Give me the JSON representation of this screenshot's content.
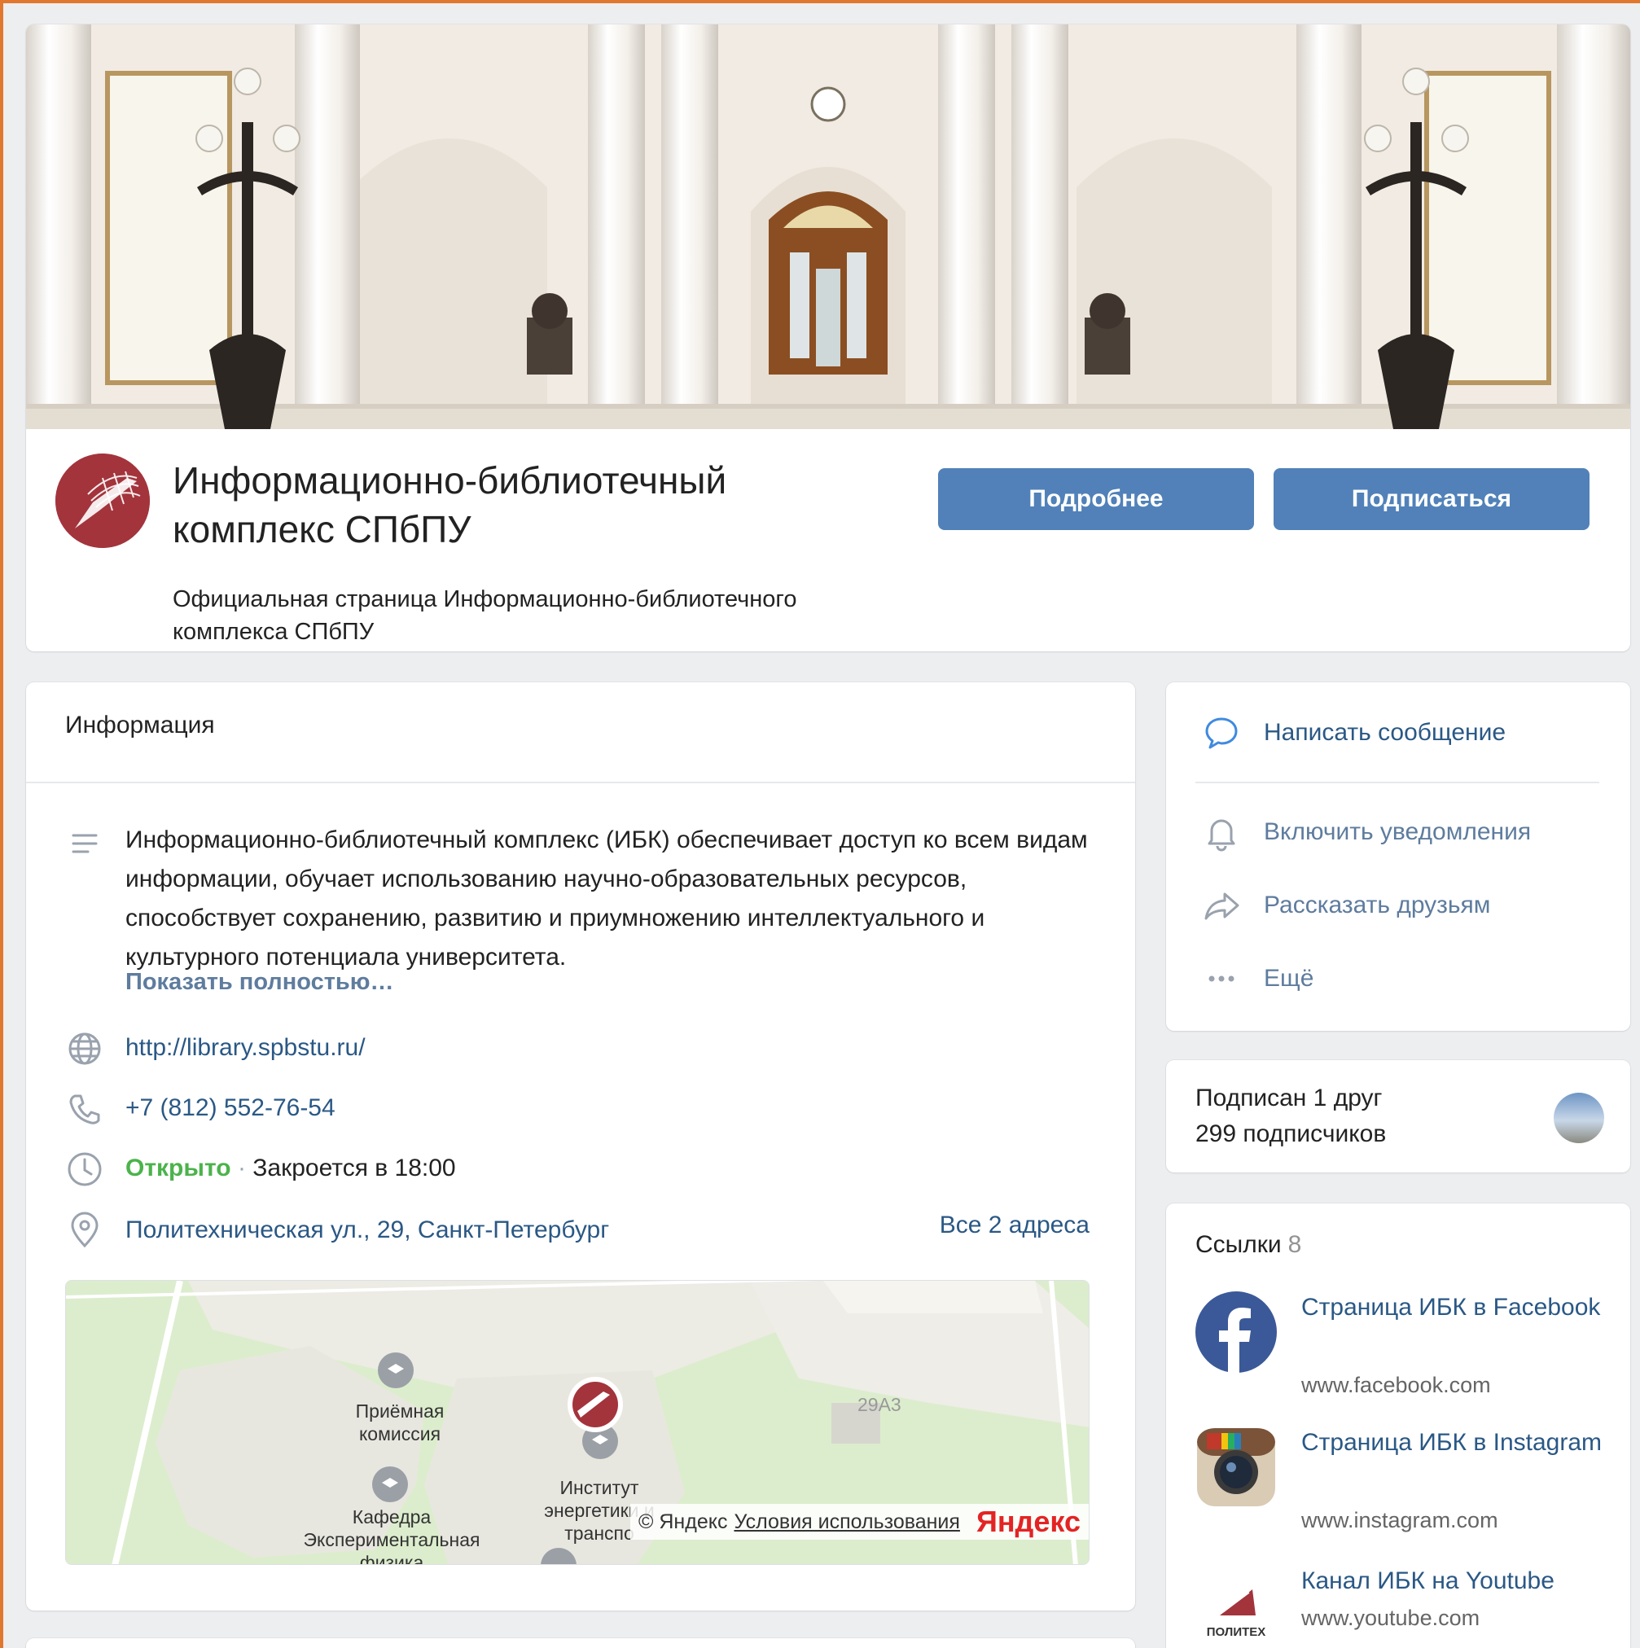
{
  "header": {
    "title": "Информационно-библиотечный комплекс СПбПУ",
    "description": "Официальная страница Информационно-библиотечного комплекса СПбПУ",
    "more_button": "Подробнее",
    "subscribe_button": "Подписаться",
    "accent_color": "#5181b8"
  },
  "info": {
    "heading": "Информация",
    "description": "Информационно-библиотечный комплекс (ИБК) обеспечивает доступ ко всем видам информации, обучает использованию научно-образовательных ресурсов, способствует сохранению, развитию и приумножению интеллектуального и культурного потенциала университета.",
    "show_full": "Показать полностью…",
    "website": "http://library.spbstu.ru/",
    "phone": "+7 (812) 552-76-54",
    "open_status": "Открыто",
    "separator": "·",
    "closes": "Закроется в 18:00",
    "address": "Политехническая ул., 29, Санкт-Петербург",
    "all_addresses": "Все 2 адреса",
    "map": {
      "label_admission": "Приёмная комиссия",
      "label_building": "29А3",
      "label_institute": "Институт энергетики и транспо",
      "label_department": "Кафедра Экспериментальная физика",
      "copyright": "© Яндекс",
      "terms": "Условия использования",
      "brand": "Яндекс"
    }
  },
  "actions": {
    "message": "Написать сообщение",
    "notifications": "Включить уведомления",
    "share": "Рассказать друзьям",
    "more": "Ещё"
  },
  "subscribers": {
    "friends": "Подписан 1 друг",
    "count": "299 подписчиков"
  },
  "links": {
    "heading": "Ссылки",
    "count": "8",
    "items": [
      {
        "title": "Страница ИБК в Facebook",
        "url": "www.facebook.com",
        "icon": "facebook-icon"
      },
      {
        "title": "Страница ИБК в Instagram",
        "url": "www.instagram.com",
        "icon": "instagram-icon"
      },
      {
        "title": "Канал ИБК на Youtube",
        "url": "www.youtube.com",
        "icon": "polytech-logo",
        "logo_text": "ПОЛИТЕХ"
      }
    ]
  }
}
